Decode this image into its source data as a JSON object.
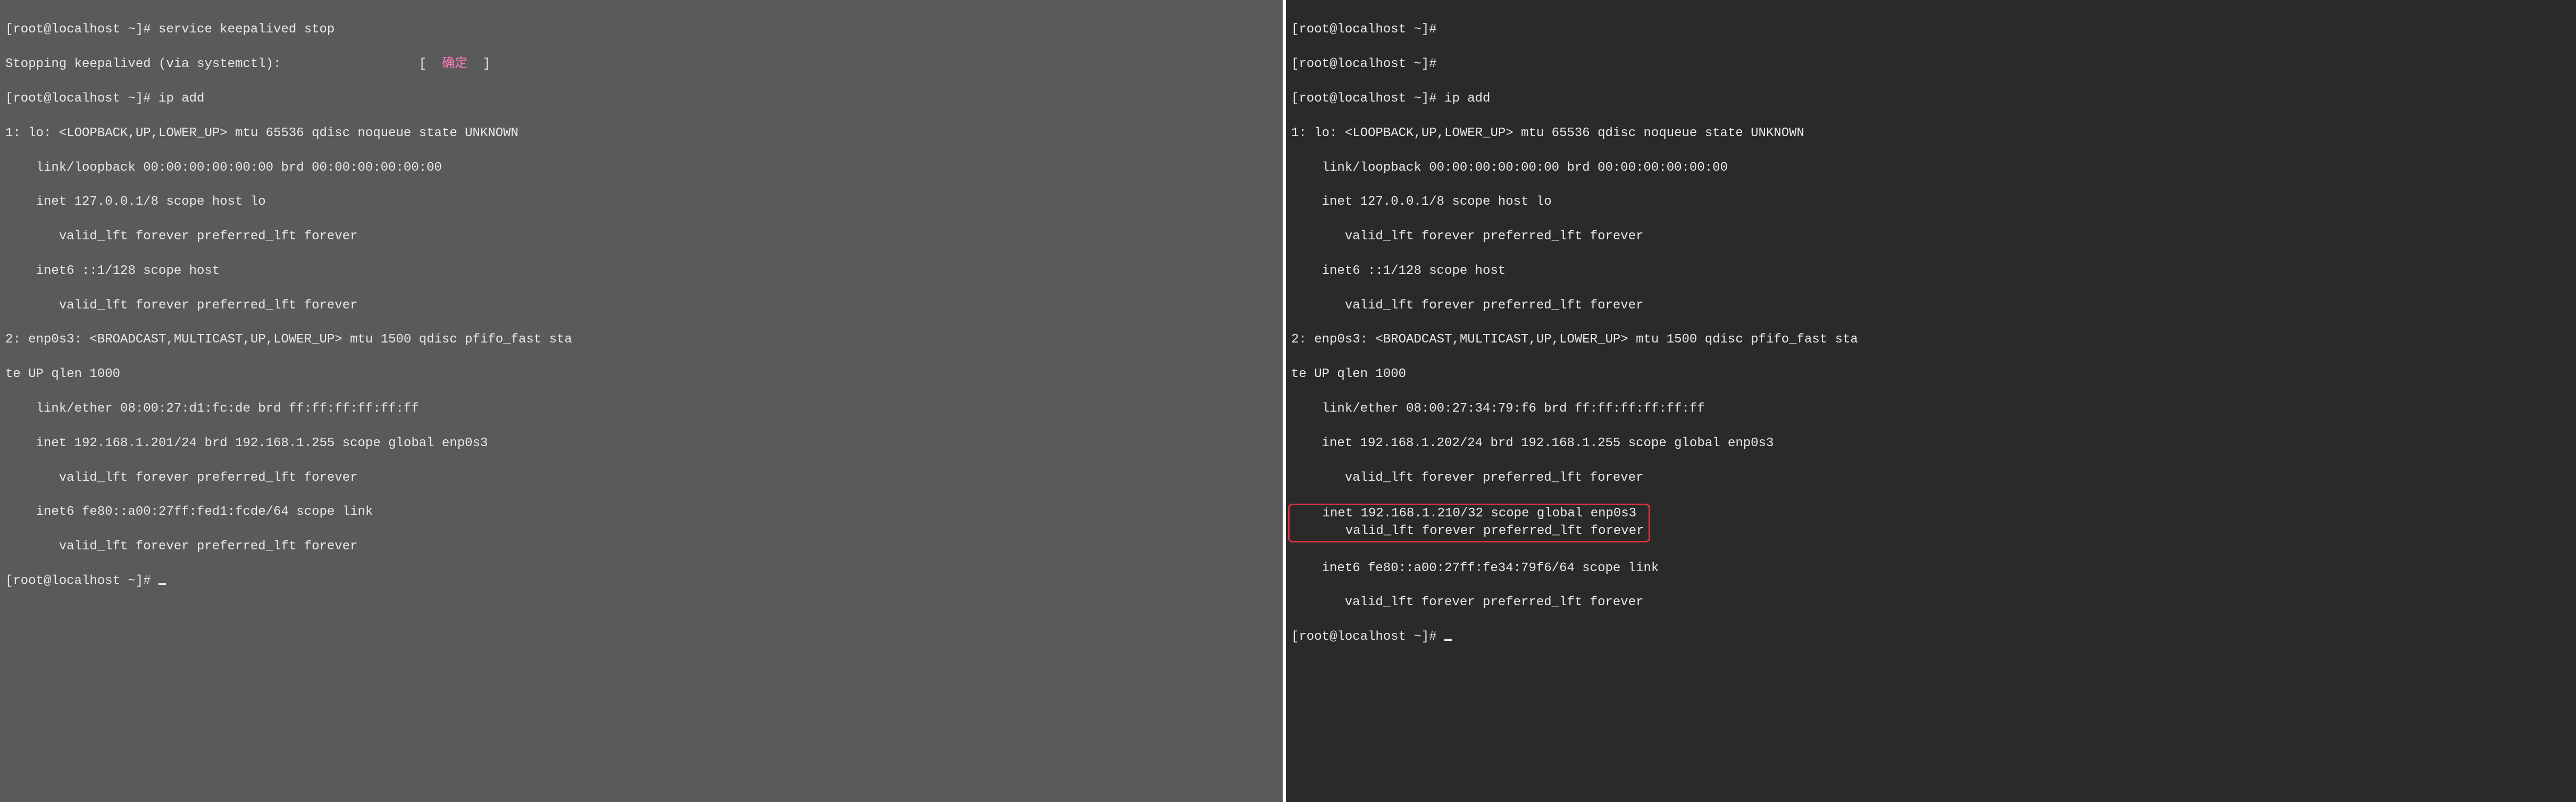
{
  "left": {
    "prompt1": "[root@localhost ~]# ",
    "cmd1": "service keepalived stop",
    "stop_line_prefix": "Stopping keepalived (via systemctl):",
    "stop_line_pad": "                  ",
    "bracket_open": "[  ",
    "ok_text": "确定",
    "bracket_close": "  ]",
    "prompt2": "[root@localhost ~]# ",
    "cmd2": "ip add",
    "if1_header": "1: lo: <LOOPBACK,UP,LOWER_UP> mtu 65536 qdisc noqueue state UNKNOWN",
    "if1_link": "    link/loopback 00:00:00:00:00:00 brd 00:00:00:00:00:00",
    "if1_inet": "    inet 127.0.0.1/8 scope host lo",
    "if1_valid": "       valid_lft forever preferred_lft forever",
    "if1_inet6": "    inet6 ::1/128 scope host",
    "if1_valid6": "       valid_lft forever preferred_lft forever",
    "if2_header": "2: enp0s3: <BROADCAST,MULTICAST,UP,LOWER_UP> mtu 1500 qdisc pfifo_fast sta",
    "if2_header_cont": "te UP qlen 1000",
    "if2_link": "    link/ether 08:00:27:d1:fc:de brd ff:ff:ff:ff:ff:ff",
    "if2_inet": "    inet 192.168.1.201/24 brd 192.168.1.255 scope global enp0s3",
    "if2_valid": "       valid_lft forever preferred_lft forever",
    "if2_inet6": "    inet6 fe80::a00:27ff:fed1:fcde/64 scope link",
    "if2_valid6": "       valid_lft forever preferred_lft forever",
    "prompt3": "[root@localhost ~]# "
  },
  "right": {
    "prompt1": "[root@localhost ~]#",
    "prompt2": "[root@localhost ~]#",
    "prompt3": "[root@localhost ~]# ",
    "cmd3": "ip add",
    "if1_header": "1: lo: <LOOPBACK,UP,LOWER_UP> mtu 65536 qdisc noqueue state UNKNOWN",
    "if1_link": "    link/loopback 00:00:00:00:00:00 brd 00:00:00:00:00:00",
    "if1_inet": "    inet 127.0.0.1/8 scope host lo",
    "if1_valid": "       valid_lft forever preferred_lft forever",
    "if1_inet6": "    inet6 ::1/128 scope host",
    "if1_valid6": "       valid_lft forever preferred_lft forever",
    "if2_header": "2: enp0s3: <BROADCAST,MULTICAST,UP,LOWER_UP> mtu 1500 qdisc pfifo_fast sta",
    "if2_header_cont": "te UP qlen 1000",
    "if2_link": "    link/ether 08:00:27:34:79:f6 brd ff:ff:ff:ff:ff:ff",
    "if2_inet": "    inet 192.168.1.202/24 brd 192.168.1.255 scope global enp0s3",
    "if2_valid": "       valid_lft forever preferred_lft forever",
    "if2_vip": "    inet 192.168.1.210/32 scope global enp0s3",
    "if2_vip_valid": "       valid_lft forever preferred_lft forever",
    "if2_inet6": "    inet6 fe80::a00:27ff:fe34:79f6/64 scope link",
    "if2_valid6": "       valid_lft forever preferred_lft forever",
    "prompt4": "[root@localhost ~]# "
  }
}
